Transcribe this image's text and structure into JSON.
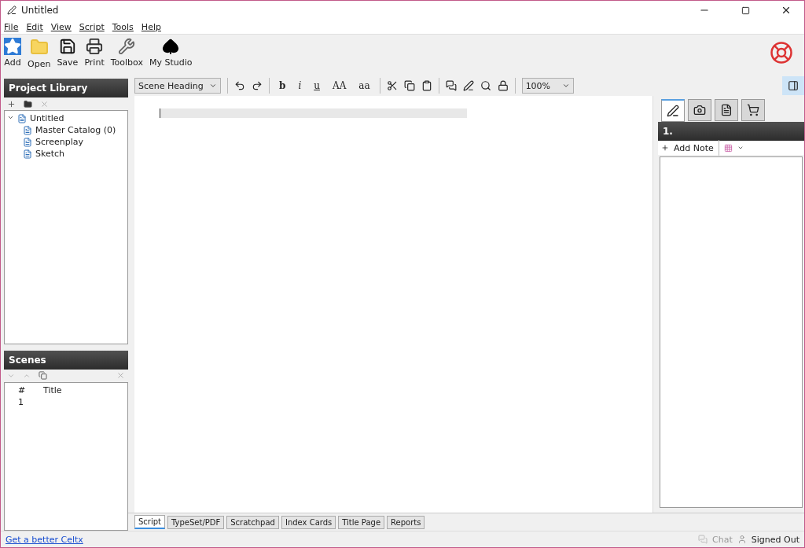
{
  "window": {
    "title": "Untitled"
  },
  "menu": [
    "File",
    "Edit",
    "View",
    "Script",
    "Tools",
    "Help"
  ],
  "toolbar": [
    {
      "label": "Add"
    },
    {
      "label": "Open"
    },
    {
      "label": "Save"
    },
    {
      "label": "Print"
    },
    {
      "label": "Toolbox"
    },
    {
      "label": "My Studio"
    }
  ],
  "project_library": {
    "title": "Project Library",
    "items": [
      {
        "label": "Untitled",
        "expanded": true,
        "children": [
          {
            "label": "Master Catalog (0)"
          },
          {
            "label": "Screenplay"
          },
          {
            "label": "Sketch"
          }
        ]
      }
    ]
  },
  "scenes": {
    "title": "Scenes",
    "columns": [
      "#",
      "Title"
    ],
    "rows": [
      {
        "number": "1"
      }
    ]
  },
  "format_toolbar": {
    "style": "Scene Heading",
    "text_buttons": [
      "b",
      "i",
      "u",
      "AA",
      "aa"
    ],
    "zoom": "100%"
  },
  "side_panel": {
    "tabs": [
      {
        "selected": true
      },
      {
        "selected": false
      },
      {
        "selected": false
      },
      {
        "selected": false
      }
    ],
    "heading": "1.",
    "add_note": "Add Note"
  },
  "bottom_tabs": [
    {
      "label": "Script",
      "selected": true
    },
    {
      "label": "TypeSet/PDF",
      "selected": false
    },
    {
      "label": "Scratchpad",
      "selected": false
    },
    {
      "label": "Index Cards",
      "selected": false
    },
    {
      "label": "Title Page",
      "selected": false
    },
    {
      "label": "Reports",
      "selected": false
    }
  ],
  "status_bar": {
    "link": "Get a better Celtx",
    "chat": "Chat",
    "account": "Signed Out"
  }
}
